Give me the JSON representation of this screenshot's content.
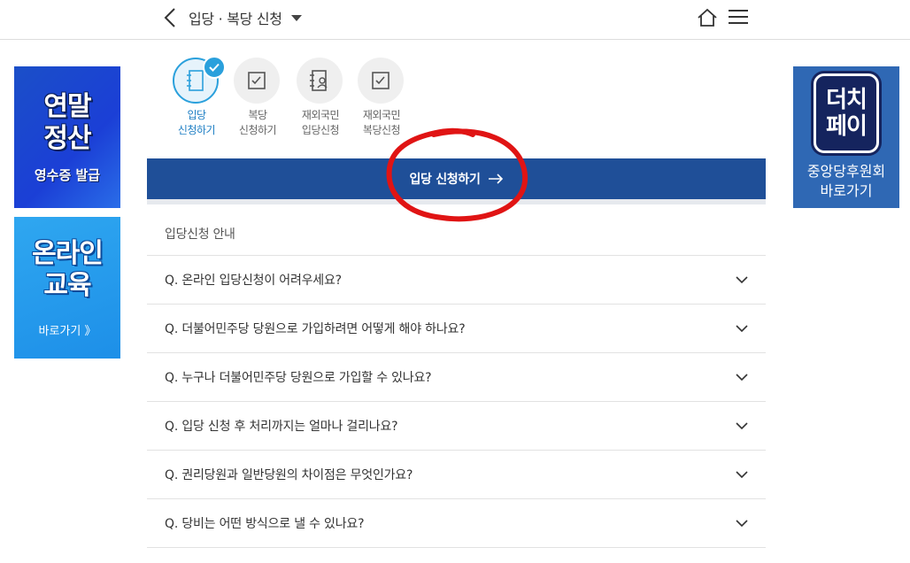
{
  "header": {
    "title": "입당 · 복당 신청"
  },
  "ads": {
    "year_end": {
      "big_line1": "연말",
      "big_line2": "정산",
      "small": "영수증 발급"
    },
    "online_edu": {
      "big_line1": "온라인",
      "big_line2": "교육",
      "small": "바로가기 》"
    },
    "pay": {
      "badge_line1": "더치",
      "badge_line2": "페이",
      "sub_line1": "중앙당후원회",
      "sub_line2": "바로가기"
    }
  },
  "steps": [
    {
      "line1": "입당",
      "line2": "신청하기",
      "active": true
    },
    {
      "line1": "복당",
      "line2": "신청하기",
      "active": false
    },
    {
      "line1": "재외국민",
      "line2": "입당신청",
      "active": false
    },
    {
      "line1": "재외국민",
      "line2": "복당신청",
      "active": false
    }
  ],
  "apply_button": {
    "label": "입당 신청하기"
  },
  "guide": {
    "title": "입당신청 안내",
    "faqs": [
      "Q. 온라인 입당신청이 어려우세요?",
      "Q. 더불어민주당 당원으로 가입하려면 어떻게 해야 하나요?",
      "Q. 누구나 더불어민주당 당원으로 가입할 수 있나요?",
      "Q. 입당 신청 후 처리까지는 얼마나 걸리나요?",
      "Q. 권리당원과 일반당원의 차이점은 무엇인가요?",
      "Q. 당비는 어떤 방식으로 낼 수 있나요?"
    ]
  },
  "colors": {
    "primary_button": "#1f4f98",
    "active_step": "#2aa0dc",
    "annotation": "#e01414"
  }
}
